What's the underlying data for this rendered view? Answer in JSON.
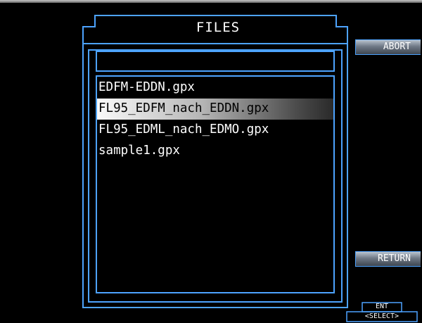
{
  "dialog": {
    "title": "FILES",
    "filename_input_value": ""
  },
  "files": [
    {
      "name": "EDFM-EDDN.gpx",
      "selected": false
    },
    {
      "name": "FL95_EDFM_nach_EDDN.gpx",
      "selected": true
    },
    {
      "name": "FL95_EDML_nach_EDMO.gpx",
      "selected": false
    },
    {
      "name": "sample1.gpx",
      "selected": false
    }
  ],
  "softkeys": {
    "abort_label": "ABORT",
    "return_label": "RETURN"
  },
  "bezel": {
    "ent_label": "ENT",
    "select_label": "<SELECT>"
  },
  "colors": {
    "background": "#000000",
    "frame_blue": "#4da3ff",
    "text": "#ffffff",
    "highlight_text": "#000000"
  }
}
